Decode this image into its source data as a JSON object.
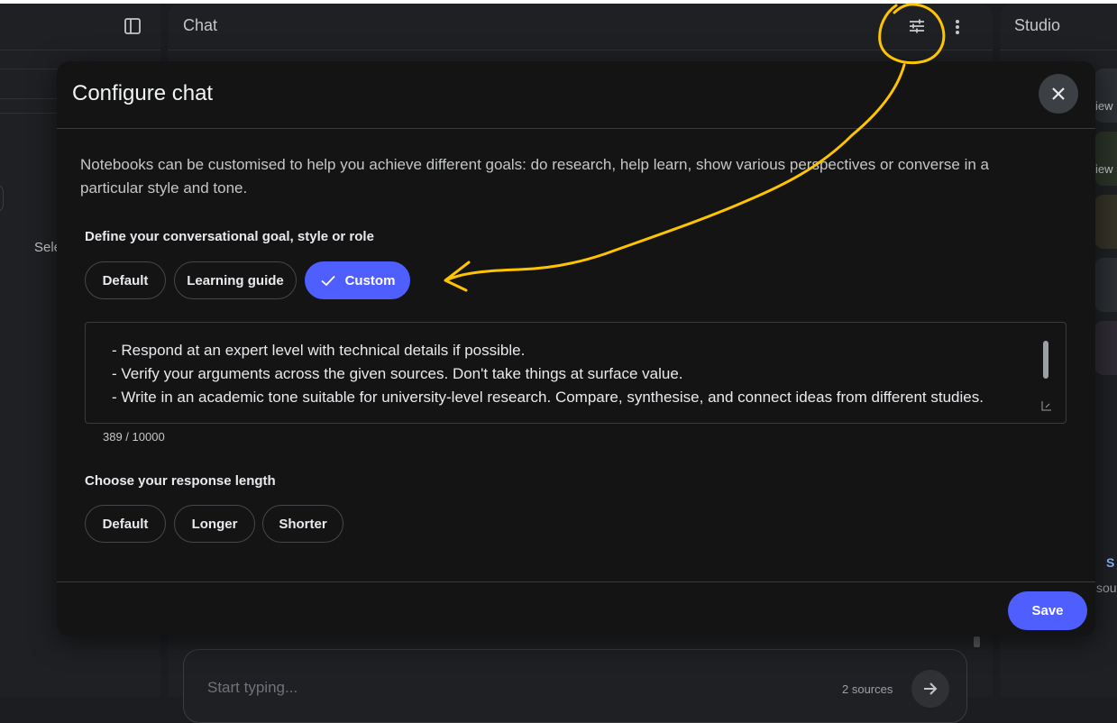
{
  "left_panel": {
    "partial_text": "Sele"
  },
  "chat_panel": {
    "title": "Chat",
    "composer": {
      "placeholder": "Start typing...",
      "sources": "2 sources"
    }
  },
  "studio_panel": {
    "title": "Studio",
    "card1_partial": "iew",
    "card2_partial": "iew",
    "blue_partial": "S",
    "sou_partial": "sou"
  },
  "modal": {
    "title": "Configure chat",
    "description": "Notebooks can be customised to help you achieve different goals: do research, help learn, show various perspectives or converse in a particular style and tone.",
    "goal_section": {
      "label": "Define your conversational goal, style or role",
      "options": [
        "Default",
        "Learning guide",
        "Custom"
      ],
      "selected": "Custom"
    },
    "prompt": {
      "lines": [
        "- Respond at an expert level with technical details if possible.",
        "- Verify your arguments across the given sources. Don't take things at surface value.",
        "- Write in an academic tone suitable for university-level research. Compare, synthesise, and connect ideas from different studies."
      ],
      "counter": "389 / 10000"
    },
    "length_section": {
      "label": "Choose your response length",
      "options": [
        "Default",
        "Longer",
        "Shorter"
      ]
    },
    "save_label": "Save"
  },
  "colors": {
    "accent": "#4f5fff",
    "annotation": "#ffc400",
    "modal_bg": "#141414"
  },
  "icons": [
    "panel-toggle-icon",
    "tune-icon",
    "more-vert-icon",
    "close-icon",
    "check-icon",
    "send-arrow-icon",
    "resize-grip-icon"
  ]
}
